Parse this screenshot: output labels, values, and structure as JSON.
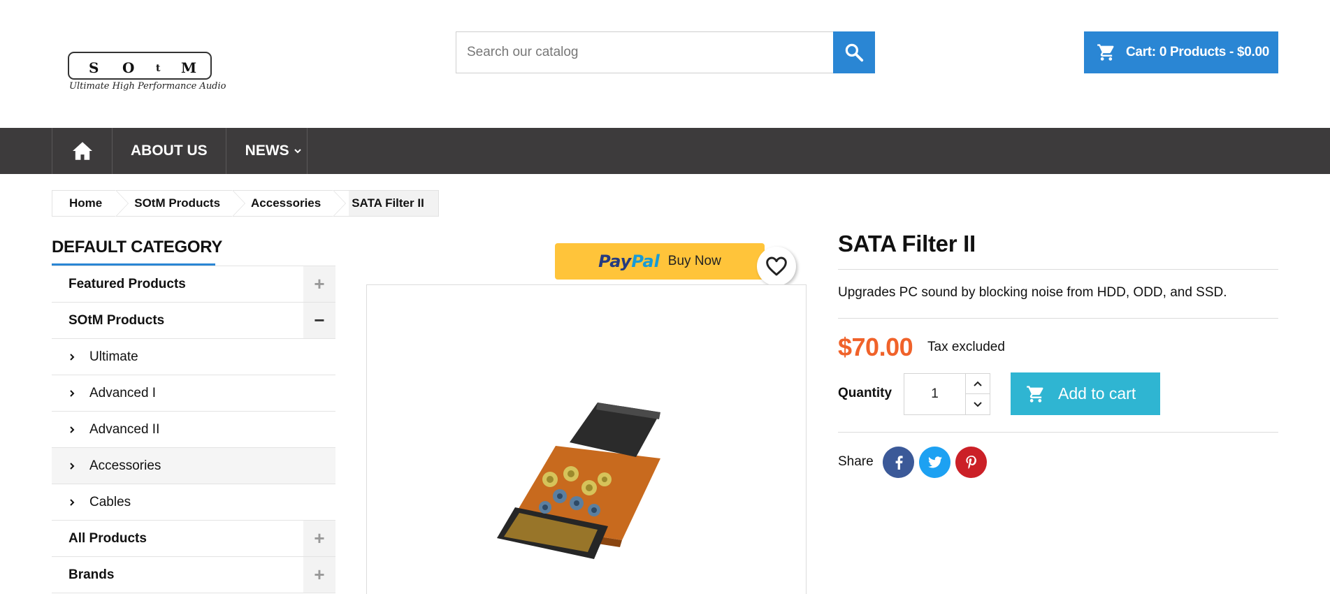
{
  "logo": {
    "letters": [
      "S",
      "O",
      "t",
      "M"
    ],
    "tagline": "Ultimate High Performance Audio"
  },
  "search": {
    "placeholder": "Search our catalog",
    "icon": "search-icon"
  },
  "cart": {
    "label": "Cart: 0 Products - $0.00",
    "icon": "shopping-cart-icon"
  },
  "nav": {
    "home_icon": "home-icon",
    "about_label": "ABOUT US",
    "news_label": "NEWS",
    "news_icon": "chevron-down-icon"
  },
  "breadcrumb": [
    "Home",
    "SOtM Products",
    "Accessories",
    "SATA Filter II"
  ],
  "sidebar": {
    "title": "DEFAULT CATEGORY",
    "items": [
      {
        "label": "Featured Products",
        "toggle": "+"
      },
      {
        "label": "SOtM Products",
        "toggle": "−"
      },
      {
        "label": "Ultimate"
      },
      {
        "label": "Advanced I"
      },
      {
        "label": "Advanced II"
      },
      {
        "label": "Accessories"
      },
      {
        "label": "Cables"
      },
      {
        "label": "All Products",
        "toggle": "+"
      },
      {
        "label": "Brands",
        "toggle": "+"
      }
    ]
  },
  "paypal": {
    "logo_part1": "Pay",
    "logo_part2": "Pal",
    "label": "Buy Now"
  },
  "product": {
    "title": "SATA Filter II",
    "description": "Upgrades PC sound by blocking noise from HDD, ODD, and SSD.",
    "price": "$70.00",
    "tax_note": "Tax excluded",
    "quantity_label": "Quantity",
    "quantity_value": "1",
    "add_to_cart_label": "Add to cart",
    "share_label": "Share"
  },
  "social": [
    {
      "name": "facebook-icon",
      "glyph": "f",
      "color": "#3b5998"
    },
    {
      "name": "twitter-icon",
      "glyph": "t",
      "color": "#1da1f2"
    },
    {
      "name": "pinterest-icon",
      "glyph": "p",
      "color": "#cb2027"
    }
  ],
  "colors": {
    "accent_blue": "#2a86d4",
    "nav_bg": "#3d3b3c",
    "price": "#f0622a",
    "add_to_cart": "#2fb5d2",
    "paypal_yellow": "#ffc43a"
  }
}
